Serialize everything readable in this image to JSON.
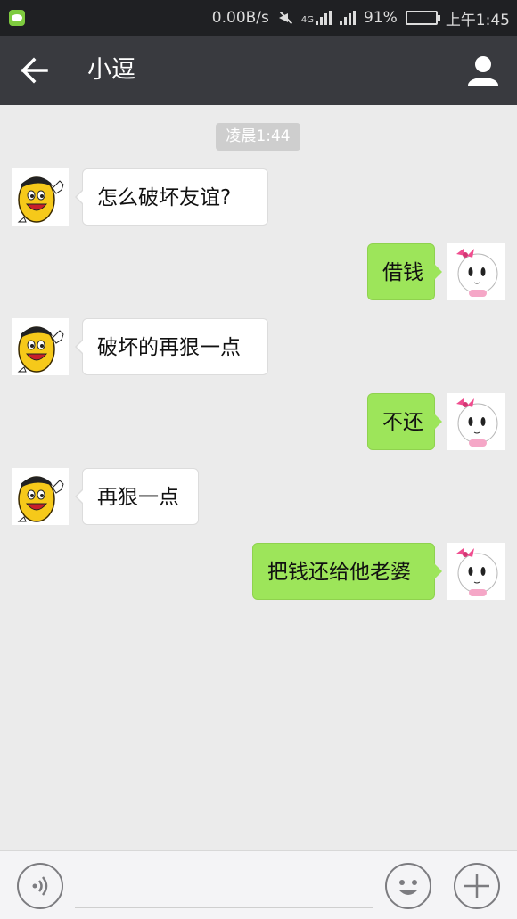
{
  "status_bar": {
    "network_speed": "0.00B/s",
    "network_type": "4G",
    "battery": "91%",
    "battery_fraction": 0.91,
    "time": "上午1:45"
  },
  "header": {
    "title": "小逗"
  },
  "chat": {
    "timestamp": "凌晨1:44",
    "messages": [
      {
        "sender": "bot",
        "text": "怎么破坏友谊?"
      },
      {
        "sender": "me",
        "text": "借钱"
      },
      {
        "sender": "bot",
        "text": "破坏的再狠一点"
      },
      {
        "sender": "me",
        "text": "不还"
      },
      {
        "sender": "bot",
        "text": "再狠一点"
      },
      {
        "sender": "me",
        "text": "把钱还给他老婆"
      }
    ]
  },
  "input_bar": {
    "placeholder": ""
  },
  "colors": {
    "header_bg": "#393a3f",
    "status_bg": "#1f2023",
    "chat_bg": "#ebebeb",
    "my_bubble": "#9de55a",
    "their_bubble": "#ffffff"
  }
}
